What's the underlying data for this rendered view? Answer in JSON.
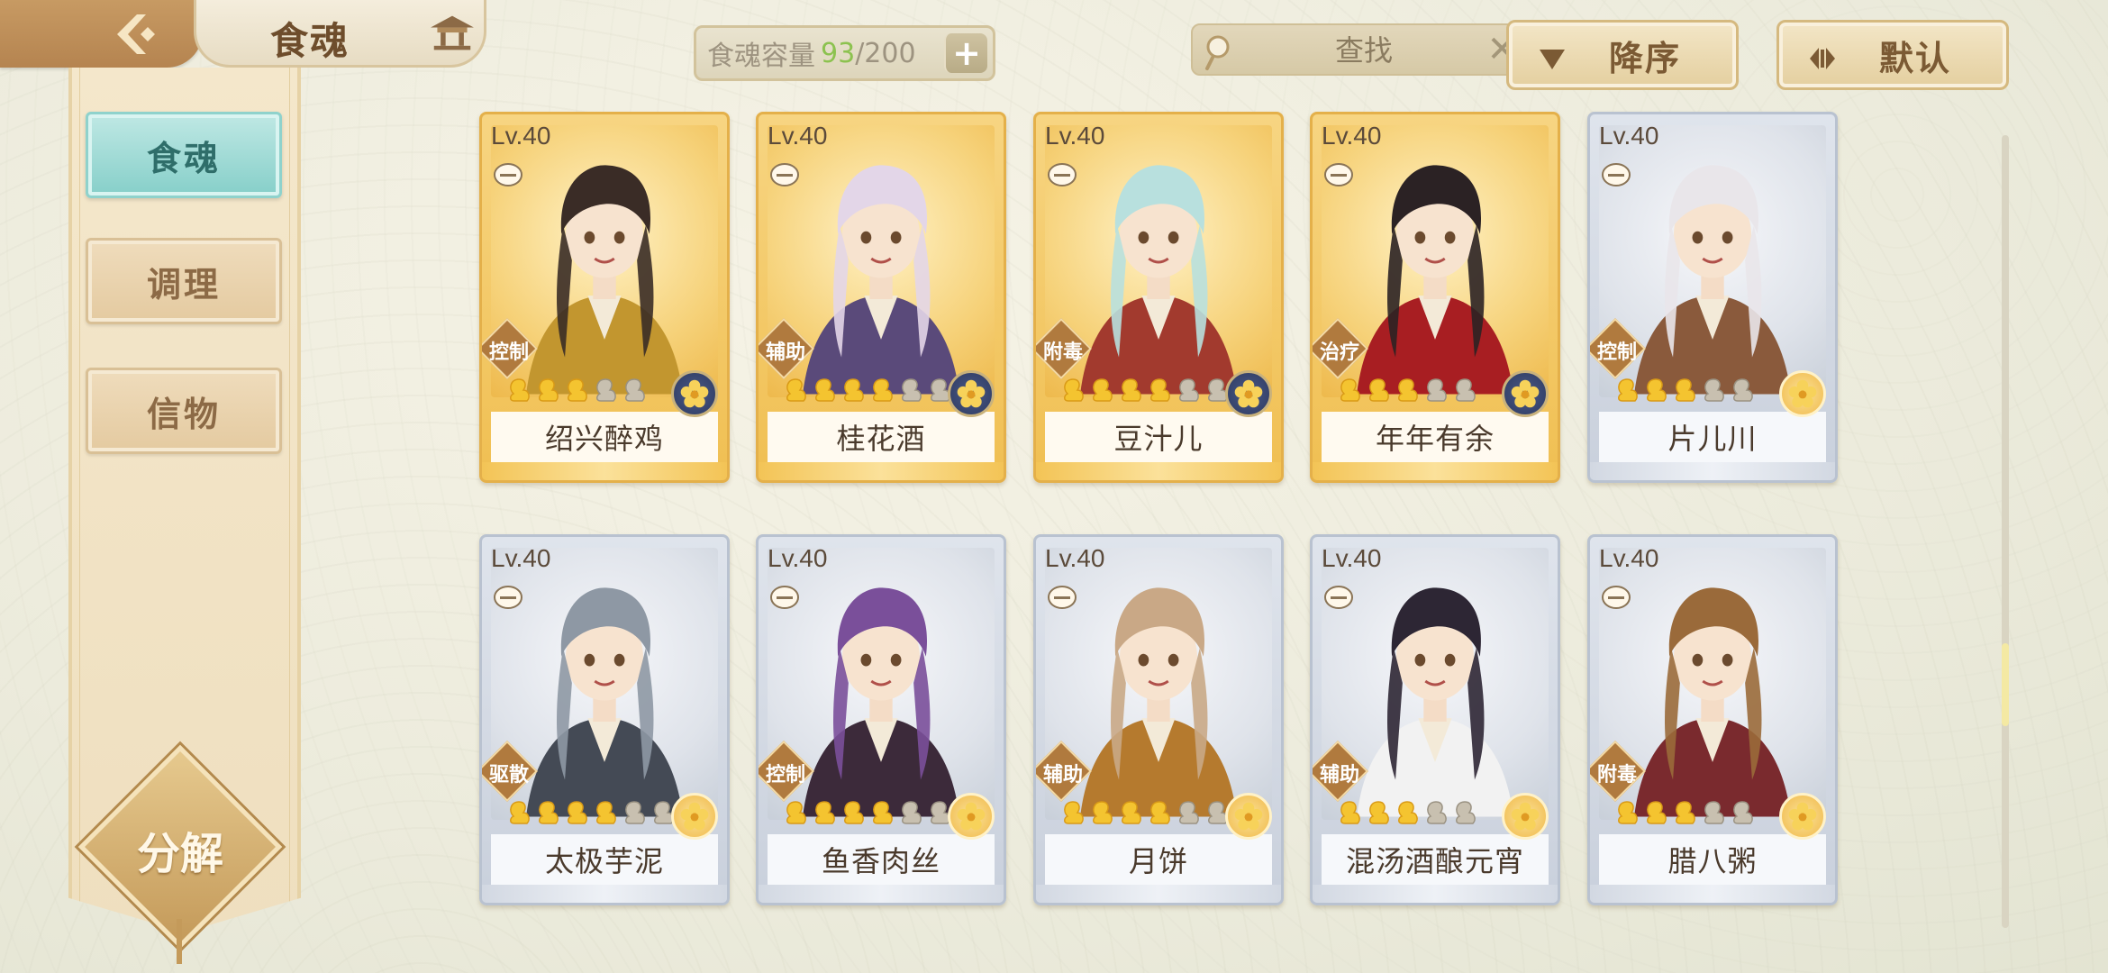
{
  "header": {
    "title": "食魂"
  },
  "sidebar": {
    "tabs": [
      {
        "label": "食魂",
        "active": true
      },
      {
        "label": "调理",
        "active": false
      },
      {
        "label": "信物",
        "active": false
      }
    ],
    "decompose_label": "分解"
  },
  "capacity": {
    "label": "食魂容量",
    "current": "93",
    "max": "/200",
    "add_symbol": "+"
  },
  "search": {
    "placeholder": "查找",
    "clear_symbol": "✕"
  },
  "sort": {
    "order_label": "降序",
    "mode_label": "默认"
  },
  "colors": {
    "capacity_current": "#8cc24f",
    "card_gold": "#f0bf52",
    "card_silver": "#c9d0dc",
    "active_tab": "#86cfc9"
  },
  "cards": [
    {
      "level": "Lv.40",
      "name": "绍兴醉鸡",
      "role": "控制",
      "stars": 3,
      "max_stars": 5,
      "rarity": "gold",
      "emblem": "blue"
    },
    {
      "level": "Lv.40",
      "name": "桂花酒",
      "role": "辅助",
      "stars": 4,
      "max_stars": 6,
      "rarity": "gold",
      "emblem": "blue"
    },
    {
      "level": "Lv.40",
      "name": "豆汁儿",
      "role": "附毒",
      "stars": 4,
      "max_stars": 6,
      "rarity": "gold",
      "emblem": "blue"
    },
    {
      "level": "Lv.40",
      "name": "年年有余",
      "role": "治疗",
      "stars": 3,
      "max_stars": 5,
      "rarity": "gold",
      "emblem": "blue"
    },
    {
      "level": "Lv.40",
      "name": "片儿川",
      "role": "控制",
      "stars": 3,
      "max_stars": 5,
      "rarity": "silver",
      "emblem": "gold"
    },
    {
      "level": "Lv.40",
      "name": "太极芋泥",
      "role": "驱散",
      "stars": 4,
      "max_stars": 6,
      "rarity": "silver",
      "emblem": "gold"
    },
    {
      "level": "Lv.40",
      "name": "鱼香肉丝",
      "role": "控制",
      "stars": 4,
      "max_stars": 6,
      "rarity": "silver",
      "emblem": "gold"
    },
    {
      "level": "Lv.40",
      "name": "月饼",
      "role": "辅助",
      "stars": 4,
      "max_stars": 6,
      "rarity": "silver",
      "emblem": "gold"
    },
    {
      "level": "Lv.40",
      "name": "混汤酒酿元宵",
      "role": "辅助",
      "stars": 3,
      "max_stars": 5,
      "rarity": "silver",
      "emblem": "gold"
    },
    {
      "level": "Lv.40",
      "name": "腊八粥",
      "role": "附毒",
      "stars": 3,
      "max_stars": 5,
      "rarity": "silver",
      "emblem": "gold"
    }
  ]
}
